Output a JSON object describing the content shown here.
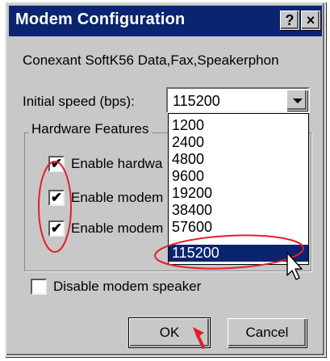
{
  "window": {
    "title": "Modem Configuration",
    "help_glyph": "?",
    "close_glyph": "×"
  },
  "device_name": "Conexant SoftK56 Data,Fax,Speakerphon",
  "speed": {
    "label": "Initial speed (bps):",
    "value": "115200",
    "options": [
      "1200",
      "2400",
      "4800",
      "9600",
      "19200",
      "38400",
      "57600",
      "115200"
    ],
    "selected": "115200"
  },
  "hardware": {
    "group_title": "Hardware Features",
    "options": [
      {
        "label": "Enable hardwa",
        "checked": true
      },
      {
        "label": "Enable modem",
        "checked": true
      },
      {
        "label": "Enable modem",
        "checked": true
      }
    ]
  },
  "disable_speaker": {
    "label": "Disable modem speaker",
    "checked": false
  },
  "buttons": {
    "ok": "OK",
    "cancel": "Cancel"
  },
  "check_glyph": "✔",
  "colors": {
    "title_bar": "#0a2470",
    "dialog_face": "#c8c8c8",
    "highlight": "#0a2470",
    "annotation": "#e0202a"
  }
}
